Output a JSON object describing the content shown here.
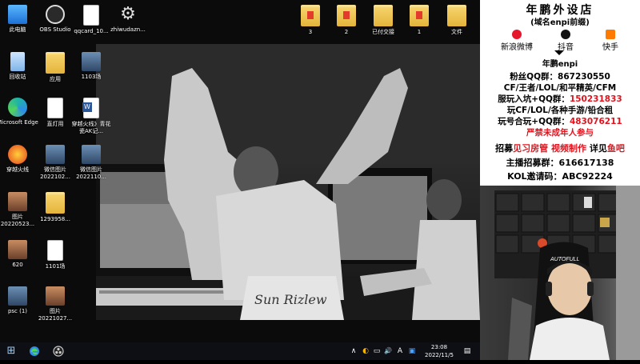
{
  "desktop_icons": [
    {
      "label": "此电脑",
      "type": "pc"
    },
    {
      "label": "OBS Studio",
      "type": "obs"
    },
    {
      "label": "qqcard_10...",
      "type": "doc"
    },
    {
      "label": "zhiwudazn...",
      "type": "gear"
    },
    {
      "label": "3",
      "type": "folder-red"
    },
    {
      "label": "2",
      "type": "folder-red"
    },
    {
      "label": "已付交接",
      "type": "folder"
    },
    {
      "label": "1",
      "type": "folder-red"
    },
    {
      "label": "文件",
      "type": "folder"
    },
    {
      "label": "回收站",
      "type": "bin"
    },
    {
      "label": "应用",
      "type": "folder"
    },
    {
      "label": "1103场",
      "type": "img"
    },
    {
      "label": "Microsoft Edge",
      "type": "edge"
    },
    {
      "label": "直灯用",
      "type": "doc"
    },
    {
      "label": "穿越火线》青花瓷AK记...",
      "type": "word"
    },
    {
      "label": "穿越火线",
      "type": "game"
    },
    {
      "label": "微信图片 2022102...",
      "type": "img"
    },
    {
      "label": "微信图片 2022110...",
      "type": "img"
    },
    {
      "label": "图片 20220523...",
      "type": "photo"
    },
    {
      "label": "1293958...",
      "type": "folder"
    },
    {
      "label": "620",
      "type": "photo"
    },
    {
      "label": "1101场",
      "type": "doc"
    },
    {
      "label": "psc (1)",
      "type": "img"
    },
    {
      "label": "图片 20221027...",
      "type": "photo"
    }
  ],
  "wallpaper_text": "Sun Rizlew",
  "taskbar": {
    "start_glyph": "⊞",
    "edge_label": "Microsoft Edge",
    "obs_label": "OBS Studio",
    "tray_glyphs": [
      "∧",
      "◐",
      "▭",
      "🔊",
      "A",
      "▣"
    ],
    "time": "23:08",
    "date": "2022/11/5",
    "notif_glyph": "▤"
  },
  "stream_overlay": {
    "shop_title": "年鹏外设店",
    "shop_subtitle": "(域名enpi前缀)",
    "socials": [
      {
        "label": "新浪微博",
        "color": "#e6162d"
      },
      {
        "label": "抖音",
        "color": "#111111"
      },
      {
        "label": "快手",
        "color": "#ff7a00"
      }
    ],
    "handle": "年鹏enpi",
    "lines": [
      {
        "text": "粉丝QQ群：867230550",
        "color": "#000000"
      },
      {
        "text": "CF/王者/LOL/和平精英/CFM",
        "color": "#000000"
      },
      {
        "text": "服玩入坑+QQ群：150231833",
        "color": "#000000",
        "highlight": "150231833",
        "hl_color": "#e0141e"
      },
      {
        "text": "玩CF/LOL/各种手游/铅合租",
        "color": "#000000"
      },
      {
        "text": "玩号合玩+QQ群：483076211",
        "color": "#000000",
        "highlight": "483076211",
        "hl_color": "#e0141e"
      },
      {
        "text": "严禁未成年人参与",
        "color": "#e0141e"
      }
    ],
    "recruit_line": {
      "prefix": "招募",
      "red1": "见习房管",
      "mid": "视频制作",
      "suffix": "详见",
      "red2": "鱼吧"
    },
    "anchor_line": "主播招募群：616617138",
    "kol_line": "KOL邀请码：ABC92224"
  },
  "webcam": {
    "chair_brand": "AUTOFULL"
  }
}
